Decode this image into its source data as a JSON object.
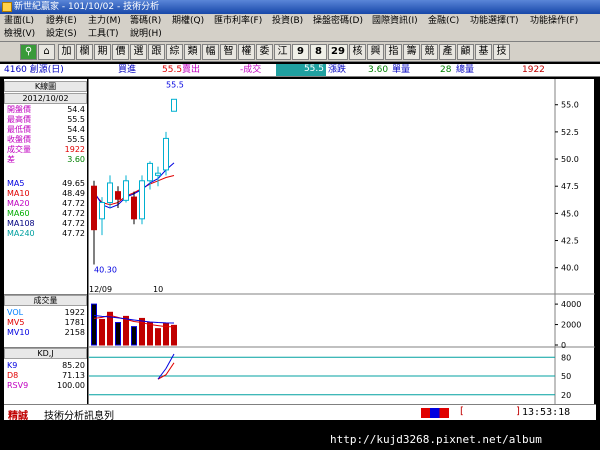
{
  "window": {
    "title": "新世紀贏家 - 101/10/02 - 技術分析"
  },
  "menu": {
    "row1": [
      "畫面(L)",
      "證券(E)",
      "主力(M)",
      "籌碼(R)",
      "期權(Q)",
      "匯市利率(F)",
      "投資(B)",
      "操盤密碼(D)",
      "國際資訊(I)",
      "金融(C)",
      "功能選擇(T)",
      "功能操作(F)"
    ],
    "row2": [
      "檢視(V)",
      "設定(S)",
      "工具(T)",
      "說明(H)"
    ]
  },
  "toolbar": {
    "buttons": [
      "加",
      "欄",
      "期",
      "價",
      "選",
      "跟",
      "綜",
      "類",
      "幅",
      "智",
      "權",
      "委",
      "江",
      "9",
      "8",
      "29",
      "核",
      "興",
      "指",
      "籌",
      "競",
      "產",
      "顧",
      "基",
      "技"
    ]
  },
  "info": {
    "code": "4160 創源(日)",
    "buy_label": "買進",
    "sell_value": "55.5",
    "sell_label": "賣出",
    "deal_label": "-成交",
    "deal_value": "55.5",
    "change_label": "漲跌",
    "change_value": "3.60",
    "volume_label": "單量",
    "total_value": "28",
    "total_label": "總量",
    "total_volume": "1922"
  },
  "side": {
    "header": "K線圖",
    "date": "2012/10/02",
    "rows": [
      {
        "label": "開盤價",
        "value": "54.4"
      },
      {
        "label": "最高價",
        "value": "55.5"
      },
      {
        "label": "最低價",
        "value": "54.4"
      },
      {
        "label": "收盤價",
        "value": "55.5"
      },
      {
        "label": "成交量",
        "value": "1922"
      },
      {
        "label": "差",
        "value": "3.60"
      }
    ],
    "ma": [
      {
        "label": "MA5",
        "value": "49.65"
      },
      {
        "label": "MA10",
        "value": "48.49"
      },
      {
        "label": "MA20",
        "value": "47.72"
      },
      {
        "label": "MA60",
        "value": "47.72"
      },
      {
        "label": "MA108",
        "value": "47.72"
      },
      {
        "label": "MA240",
        "value": "47.72"
      }
    ],
    "vol_header": "成交量",
    "vol": [
      {
        "label": "VOL",
        "value": "1922"
      },
      {
        "label": "MV5",
        "value": "1781"
      },
      {
        "label": "MV10",
        "value": "2158"
      }
    ],
    "kd_header": "KD,J",
    "kd": [
      {
        "label": "K9",
        "value": "85.20"
      },
      {
        "label": "D8",
        "value": "71.13"
      },
      {
        "label": "RSV9",
        "value": "100.00"
      }
    ]
  },
  "chart_data": {
    "type": "candlestick",
    "price": {
      "ylim": [
        38.5,
        57
      ],
      "ticks": [
        "55.0",
        "52.5",
        "50.0",
        "47.5",
        "45.0",
        "42.5",
        "40.0"
      ],
      "tick_values": [
        55.0,
        52.5,
        50.0,
        47.5,
        45.0,
        42.5,
        40.0
      ],
      "x_labels": [
        "12/09",
        "10"
      ],
      "x_label_index": [
        0,
        8
      ],
      "high_label": "55.5",
      "low_label": "40.30",
      "candles": [
        {
          "o": 47.5,
          "h": 48.0,
          "l": 40.3,
          "c": 43.5
        },
        {
          "o": 44.5,
          "h": 46.5,
          "l": 43.0,
          "c": 46.0
        },
        {
          "o": 46.0,
          "h": 48.5,
          "l": 45.5,
          "c": 47.8
        },
        {
          "o": 47.0,
          "h": 47.5,
          "l": 45.5,
          "c": 46.3
        },
        {
          "o": 46.2,
          "h": 48.5,
          "l": 46.0,
          "c": 48.0
        },
        {
          "o": 46.5,
          "h": 47.0,
          "l": 44.0,
          "c": 44.5
        },
        {
          "o": 44.5,
          "h": 48.5,
          "l": 44.0,
          "c": 48.0
        },
        {
          "o": 48.0,
          "h": 49.8,
          "l": 47.2,
          "c": 49.6
        },
        {
          "o": 48.5,
          "h": 49.3,
          "l": 47.5,
          "c": 48.7
        },
        {
          "o": 49.0,
          "h": 52.5,
          "l": 48.5,
          "c": 51.9
        },
        {
          "o": 54.4,
          "h": 55.5,
          "l": 54.4,
          "c": 55.5
        }
      ],
      "ma5": [
        47.0,
        45.8,
        45.5,
        45.8,
        46.5,
        46.8,
        47.2,
        47.8,
        48.2,
        49.0,
        49.65
      ],
      "ma10": [
        46.8,
        46.0,
        45.8,
        46.0,
        46.6,
        46.9,
        47.3,
        47.7,
        48.0,
        48.3,
        48.49
      ]
    },
    "volume": {
      "ylim": [
        0,
        4500
      ],
      "ticks": [
        "4000",
        "2000",
        "0"
      ],
      "tick_values": [
        4000,
        2000,
        0
      ],
      "bars": [
        4000,
        2500,
        3200,
        2200,
        2800,
        1800,
        2600,
        2200,
        1600,
        2100,
        1922
      ],
      "up": [
        false,
        true,
        true,
        false,
        true,
        false,
        true,
        true,
        true,
        true,
        true
      ]
    },
    "kd": {
      "ylim": [
        10,
        90
      ],
      "ticks": [
        "80",
        "50",
        "20"
      ],
      "tick_values": [
        80,
        50,
        20
      ],
      "k": [
        null,
        null,
        null,
        null,
        null,
        null,
        null,
        null,
        45,
        62,
        85.2
      ],
      "d": [
        null,
        null,
        null,
        null,
        null,
        null,
        null,
        null,
        45,
        52,
        71.13
      ]
    }
  },
  "status": {
    "label1": "精誠",
    "label2": "技術分析訊息列",
    "time": "13:53:18"
  },
  "watermark": "http://kujd3268.pixnet.net/album"
}
